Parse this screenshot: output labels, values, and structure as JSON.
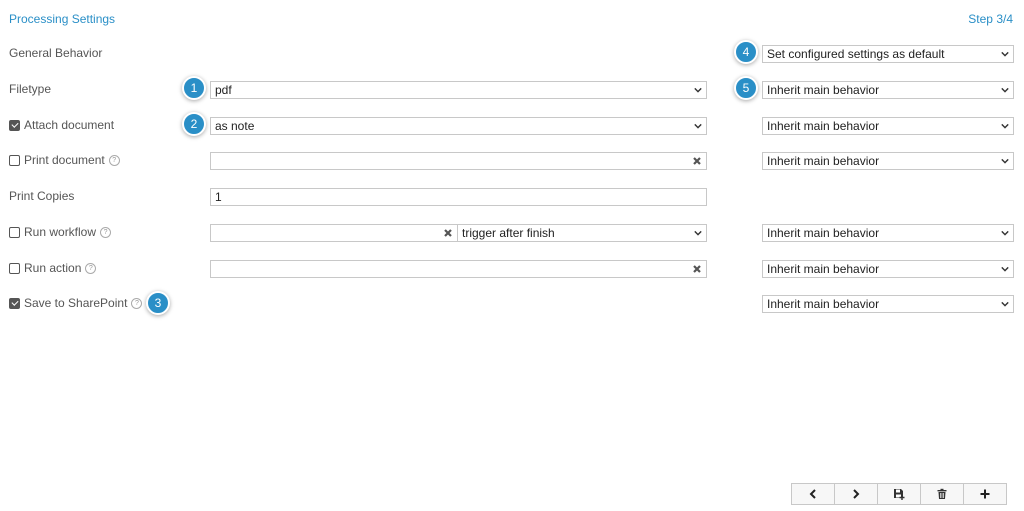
{
  "header": {
    "title": "Processing Settings",
    "step": "Step 3/4"
  },
  "rows": {
    "general": {
      "label": "General Behavior",
      "behavior": "Set configured settings as default"
    },
    "filetype": {
      "label": "Filetype",
      "value": "pdf",
      "behavior": "Inherit main behavior"
    },
    "attach": {
      "label": "Attach document",
      "checked": true,
      "value": "as note",
      "behavior": "Inherit main behavior"
    },
    "print": {
      "label": "Print document",
      "checked": false,
      "value": "",
      "behavior": "Inherit main behavior"
    },
    "copies": {
      "label": "Print Copies",
      "value": "1"
    },
    "workflow": {
      "label": "Run workflow",
      "checked": false,
      "value": "",
      "trigger": "trigger after finish",
      "behavior": "Inherit main behavior"
    },
    "action": {
      "label": "Run action",
      "checked": false,
      "value": "",
      "behavior": "Inherit main behavior"
    },
    "sharepoint": {
      "label": "Save to SharePoint",
      "checked": true,
      "behavior": "Inherit main behavior"
    }
  },
  "badges": [
    "1",
    "2",
    "3",
    "4",
    "5"
  ],
  "help_glyph": "?",
  "toolbar": [
    "chevron-left-icon",
    "chevron-right-icon",
    "save-icon",
    "trash-icon",
    "plus-icon"
  ],
  "colors": {
    "accent": "#2a8fc7",
    "text": "#555555",
    "border": "#c8c8c8"
  }
}
